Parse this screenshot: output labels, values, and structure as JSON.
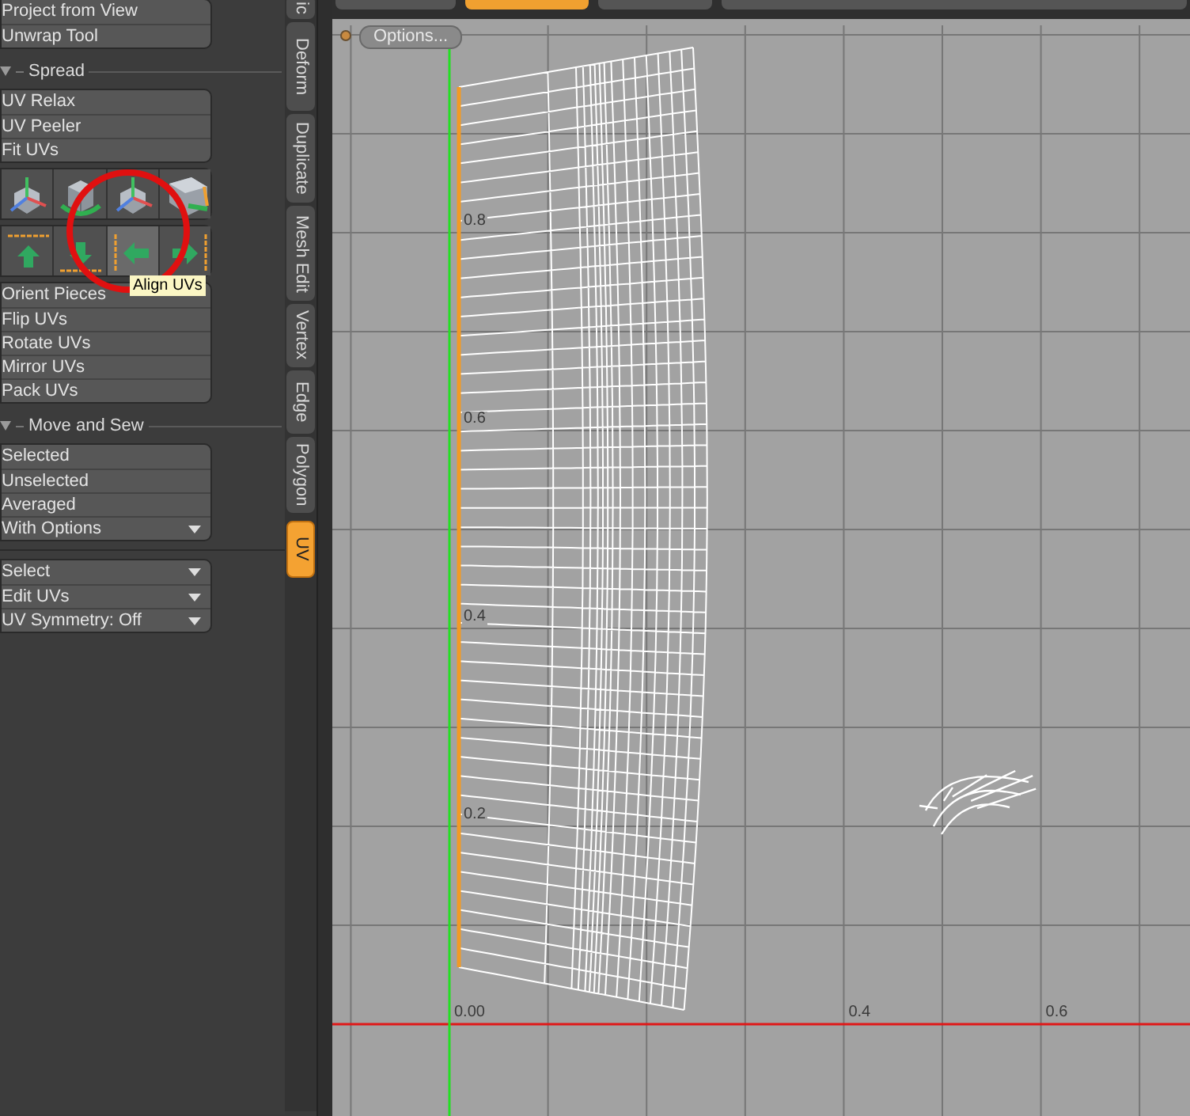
{
  "panel": {
    "sections": [
      {
        "kind": "buttons",
        "items": [
          {
            "label": "Project from View",
            "dropdown": false
          },
          {
            "label": "Unwrap Tool",
            "dropdown": false
          }
        ]
      },
      {
        "kind": "header",
        "label": "Spread"
      },
      {
        "kind": "buttons",
        "items": [
          {
            "label": "UV Relax",
            "dropdown": false
          },
          {
            "label": "UV Peeler",
            "dropdown": false
          },
          {
            "label": "Fit UVs",
            "dropdown": false
          }
        ]
      },
      {
        "kind": "tools",
        "tools": [
          {
            "hovered": false
          },
          {
            "hovered": false
          },
          {
            "hovered": false
          },
          {
            "hovered": false
          }
        ]
      },
      {
        "kind": "tools",
        "tools": [
          {
            "hovered": false
          },
          {
            "hovered": false
          },
          {
            "hovered": true
          },
          {
            "hovered": false
          }
        ]
      },
      {
        "kind": "buttons",
        "items": [
          {
            "label": "Orient Pieces",
            "dropdown": false
          },
          {
            "label": "Flip UVs",
            "dropdown": false
          },
          {
            "label": "Rotate UVs",
            "dropdown": false
          },
          {
            "label": "Mirror UVs",
            "dropdown": false
          },
          {
            "label": "Pack UVs",
            "dropdown": false
          }
        ]
      },
      {
        "kind": "header",
        "label": "Move and Sew"
      },
      {
        "kind": "buttons",
        "items": [
          {
            "label": "Selected",
            "dropdown": false
          },
          {
            "label": "Unselected",
            "dropdown": false
          },
          {
            "label": "Averaged",
            "dropdown": false
          },
          {
            "label": "With Options",
            "dropdown": true
          }
        ]
      },
      {
        "kind": "divider"
      },
      {
        "kind": "buttons",
        "items": [
          {
            "label": "Select",
            "dropdown": true
          },
          {
            "label": "Edit UVs",
            "dropdown": true
          },
          {
            "label": "UV Symmetry: Off",
            "dropdown": true
          }
        ]
      }
    ],
    "tooltip": "Align UVs"
  },
  "tabs": [
    {
      "label": "ic",
      "selected": false
    },
    {
      "label": "Deform",
      "selected": false
    },
    {
      "label": "Duplicate",
      "selected": false
    },
    {
      "label": "Mesh Edit",
      "selected": false
    },
    {
      "label": "Vertex",
      "selected": false
    },
    {
      "label": "Edge",
      "selected": false
    },
    {
      "label": "Polygon",
      "selected": false
    },
    {
      "label": "UV",
      "selected": true
    }
  ],
  "viewport_tabs": [
    {
      "selected": false
    },
    {
      "selected": true
    },
    {
      "selected": false
    },
    {
      "selected": false
    }
  ],
  "viewport": {
    "options_button": "Options...",
    "y_labels": [
      "0.8",
      "0.6",
      "0.4",
      "0.2"
    ],
    "x_labels": [
      "0.00",
      "0.4",
      "0.6"
    ]
  }
}
